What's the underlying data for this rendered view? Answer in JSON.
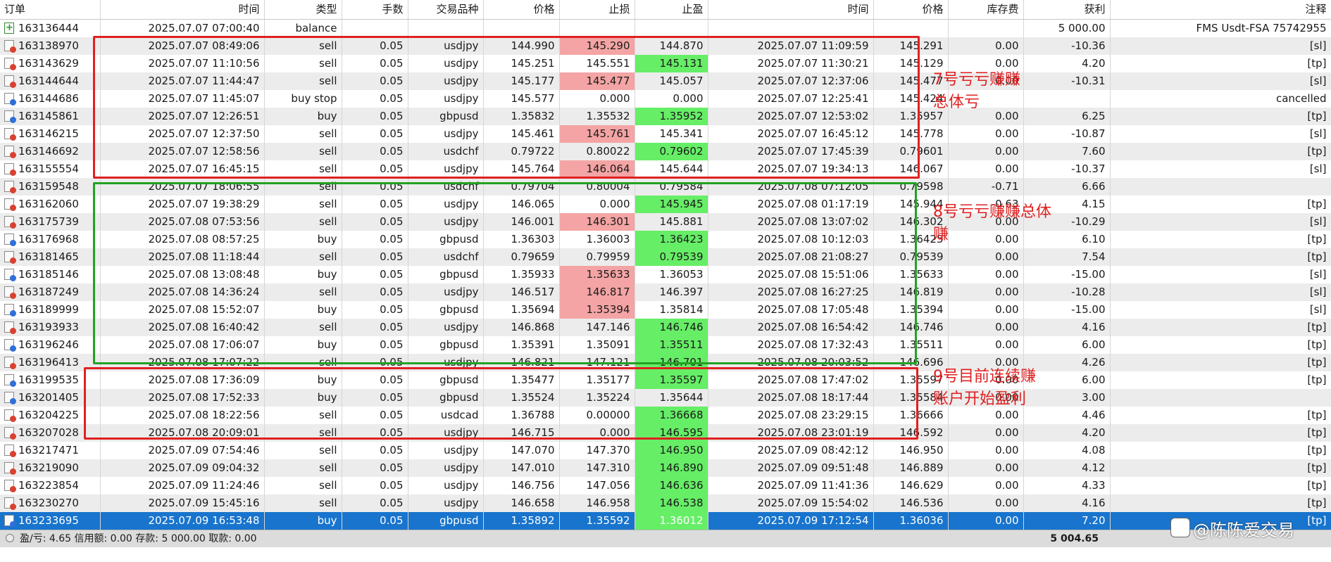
{
  "columns": {
    "order": "订单",
    "time_open": "时间",
    "type": "类型",
    "volume": "手数",
    "symbol": "交易品种",
    "price_open": "价格",
    "sl": "止损",
    "tp": "止盈",
    "time_close": "时间",
    "price_close": "价格",
    "swap": "库存费",
    "profit": "获利",
    "comment": "注释"
  },
  "rows": [
    {
      "order": "163136444",
      "time_open": "2025.07.07 07:00:40",
      "type": "balance",
      "volume": "",
      "symbol": "",
      "price_open": "",
      "sl": "",
      "tp": "",
      "time_close": "",
      "price_close": "",
      "swap": "",
      "profit": "5 000.00",
      "comment": "FMS Usdt-FSA 75742955",
      "icon": "balance-icon"
    },
    {
      "order": "163138970",
      "time_open": "2025.07.07 08:49:06",
      "type": "sell",
      "volume": "0.05",
      "symbol": "usdjpy",
      "price_open": "144.990",
      "sl": "145.290",
      "tp": "144.870",
      "time_close": "2025.07.07 11:09:59",
      "price_close": "145.291",
      "swap": "0.00",
      "profit": "-10.36",
      "comment": "[sl]",
      "hit": "sl",
      "icon": "sell-order-icon"
    },
    {
      "order": "163143629",
      "time_open": "2025.07.07 11:10:56",
      "type": "sell",
      "volume": "0.05",
      "symbol": "usdjpy",
      "price_open": "145.251",
      "sl": "145.551",
      "tp": "145.131",
      "time_close": "2025.07.07 11:30:21",
      "price_close": "145.129",
      "swap": "0.00",
      "profit": "4.20",
      "comment": "[tp]",
      "hit": "tp",
      "icon": "sell-order-icon"
    },
    {
      "order": "163144644",
      "time_open": "2025.07.07 11:44:47",
      "type": "sell",
      "volume": "0.05",
      "symbol": "usdjpy",
      "price_open": "145.177",
      "sl": "145.477",
      "tp": "145.057",
      "time_close": "2025.07.07 12:37:06",
      "price_close": "145.477",
      "swap": "0.00",
      "profit": "-10.31",
      "comment": "[sl]",
      "hit": "sl",
      "icon": "sell-order-icon"
    },
    {
      "order": "163144686",
      "time_open": "2025.07.07 11:45:07",
      "type": "buy stop",
      "volume": "0.05",
      "symbol": "usdjpy",
      "price_open": "145.577",
      "sl": "0.000",
      "tp": "0.000",
      "time_close": "2025.07.07 12:25:41",
      "price_close": "145.424",
      "swap": "",
      "profit": "",
      "comment": "cancelled",
      "hit": "",
      "icon": "buy-order-icon"
    },
    {
      "order": "163145861",
      "time_open": "2025.07.07 12:26:51",
      "type": "buy",
      "volume": "0.05",
      "symbol": "gbpusd",
      "price_open": "1.35832",
      "sl": "1.35532",
      "tp": "1.35952",
      "time_close": "2025.07.07 12:53:02",
      "price_close": "1.35957",
      "swap": "0.00",
      "profit": "6.25",
      "comment": "[tp]",
      "hit": "tp",
      "icon": "buy-order-icon"
    },
    {
      "order": "163146215",
      "time_open": "2025.07.07 12:37:50",
      "type": "sell",
      "volume": "0.05",
      "symbol": "usdjpy",
      "price_open": "145.461",
      "sl": "145.761",
      "tp": "145.341",
      "time_close": "2025.07.07 16:45:12",
      "price_close": "145.778",
      "swap": "0.00",
      "profit": "-10.87",
      "comment": "[sl]",
      "hit": "sl",
      "icon": "sell-order-icon"
    },
    {
      "order": "163146692",
      "time_open": "2025.07.07 12:58:56",
      "type": "sell",
      "volume": "0.05",
      "symbol": "usdchf",
      "price_open": "0.79722",
      "sl": "0.80022",
      "tp": "0.79602",
      "time_close": "2025.07.07 17:45:39",
      "price_close": "0.79601",
      "swap": "0.00",
      "profit": "7.60",
      "comment": "[tp]",
      "hit": "tp",
      "icon": "sell-order-icon"
    },
    {
      "order": "163155554",
      "time_open": "2025.07.07 16:45:15",
      "type": "sell",
      "volume": "0.05",
      "symbol": "usdjpy",
      "price_open": "145.764",
      "sl": "146.064",
      "tp": "145.644",
      "time_close": "2025.07.07 19:34:13",
      "price_close": "146.067",
      "swap": "0.00",
      "profit": "-10.37",
      "comment": "[sl]",
      "hit": "sl",
      "icon": "sell-order-icon"
    },
    {
      "order": "163159548",
      "time_open": "2025.07.07 18:06:55",
      "type": "sell",
      "volume": "0.05",
      "symbol": "usdchf",
      "price_open": "0.79704",
      "sl": "0.80004",
      "tp": "0.79584",
      "time_close": "2025.07.08 07:12:05",
      "price_close": "0.79598",
      "swap": "-0.71",
      "profit": "6.66",
      "comment": "",
      "hit": "",
      "icon": "sell-order-icon"
    },
    {
      "order": "163162060",
      "time_open": "2025.07.07 19:38:29",
      "type": "sell",
      "volume": "0.05",
      "symbol": "usdjpy",
      "price_open": "146.065",
      "sl": "0.000",
      "tp": "145.945",
      "time_close": "2025.07.08 01:17:19",
      "price_close": "145.944",
      "swap": "-0.63",
      "profit": "4.15",
      "comment": "[tp]",
      "hit": "tp",
      "icon": "sell-order-icon"
    },
    {
      "order": "163175739",
      "time_open": "2025.07.08 07:53:56",
      "type": "sell",
      "volume": "0.05",
      "symbol": "usdjpy",
      "price_open": "146.001",
      "sl": "146.301",
      "tp": "145.881",
      "time_close": "2025.07.08 13:07:02",
      "price_close": "146.302",
      "swap": "0.00",
      "profit": "-10.29",
      "comment": "[sl]",
      "hit": "sl",
      "icon": "sell-order-icon"
    },
    {
      "order": "163176968",
      "time_open": "2025.07.08 08:57:25",
      "type": "buy",
      "volume": "0.05",
      "symbol": "gbpusd",
      "price_open": "1.36303",
      "sl": "1.36003",
      "tp": "1.36423",
      "time_close": "2025.07.08 10:12:03",
      "price_close": "1.36425",
      "swap": "0.00",
      "profit": "6.10",
      "comment": "[tp]",
      "hit": "tp",
      "icon": "buy-order-icon"
    },
    {
      "order": "163181465",
      "time_open": "2025.07.08 11:18:44",
      "type": "sell",
      "volume": "0.05",
      "symbol": "usdchf",
      "price_open": "0.79659",
      "sl": "0.79959",
      "tp": "0.79539",
      "time_close": "2025.07.08 21:08:27",
      "price_close": "0.79539",
      "swap": "0.00",
      "profit": "7.54",
      "comment": "[tp]",
      "hit": "tp",
      "icon": "sell-order-icon"
    },
    {
      "order": "163185146",
      "time_open": "2025.07.08 13:08:48",
      "type": "buy",
      "volume": "0.05",
      "symbol": "gbpusd",
      "price_open": "1.35933",
      "sl": "1.35633",
      "tp": "1.36053",
      "time_close": "2025.07.08 15:51:06",
      "price_close": "1.35633",
      "swap": "0.00",
      "profit": "-15.00",
      "comment": "[sl]",
      "hit": "sl",
      "icon": "buy-order-icon"
    },
    {
      "order": "163187249",
      "time_open": "2025.07.08 14:36:24",
      "type": "sell",
      "volume": "0.05",
      "symbol": "usdjpy",
      "price_open": "146.517",
      "sl": "146.817",
      "tp": "146.397",
      "time_close": "2025.07.08 16:27:25",
      "price_close": "146.819",
      "swap": "0.00",
      "profit": "-10.28",
      "comment": "[sl]",
      "hit": "sl",
      "icon": "sell-order-icon"
    },
    {
      "order": "163189999",
      "time_open": "2025.07.08 15:52:07",
      "type": "buy",
      "volume": "0.05",
      "symbol": "gbpusd",
      "price_open": "1.35694",
      "sl": "1.35394",
      "tp": "1.35814",
      "time_close": "2025.07.08 17:05:48",
      "price_close": "1.35394",
      "swap": "0.00",
      "profit": "-15.00",
      "comment": "[sl]",
      "hit": "sl",
      "icon": "buy-order-icon"
    },
    {
      "order": "163193933",
      "time_open": "2025.07.08 16:40:42",
      "type": "sell",
      "volume": "0.05",
      "symbol": "usdjpy",
      "price_open": "146.868",
      "sl": "147.146",
      "tp": "146.746",
      "time_close": "2025.07.08 16:54:42",
      "price_close": "146.746",
      "swap": "0.00",
      "profit": "4.16",
      "comment": "[tp]",
      "hit": "tp",
      "icon": "sell-order-icon"
    },
    {
      "order": "163196246",
      "time_open": "2025.07.08 17:06:07",
      "type": "buy",
      "volume": "0.05",
      "symbol": "gbpusd",
      "price_open": "1.35391",
      "sl": "1.35091",
      "tp": "1.35511",
      "time_close": "2025.07.08 17:32:43",
      "price_close": "1.35511",
      "swap": "0.00",
      "profit": "6.00",
      "comment": "[tp]",
      "hit": "tp",
      "icon": "buy-order-icon"
    },
    {
      "order": "163196413",
      "time_open": "2025.07.08 17:07:22",
      "type": "sell",
      "volume": "0.05",
      "symbol": "usdjpy",
      "price_open": "146.821",
      "sl": "147.121",
      "tp": "146.701",
      "time_close": "2025.07.08 20:03:52",
      "price_close": "146.696",
      "swap": "0.00",
      "profit": "4.26",
      "comment": "[tp]",
      "hit": "tp",
      "icon": "sell-order-icon"
    },
    {
      "order": "163199535",
      "time_open": "2025.07.08 17:36:09",
      "type": "buy",
      "volume": "0.05",
      "symbol": "gbpusd",
      "price_open": "1.35477",
      "sl": "1.35177",
      "tp": "1.35597",
      "time_close": "2025.07.08 17:47:02",
      "price_close": "1.35597",
      "swap": "0.00",
      "profit": "6.00",
      "comment": "[tp]",
      "hit": "tp",
      "icon": "buy-order-icon"
    },
    {
      "order": "163201405",
      "time_open": "2025.07.08 17:52:33",
      "type": "buy",
      "volume": "0.05",
      "symbol": "gbpusd",
      "price_open": "1.35524",
      "sl": "1.35224",
      "tp": "1.35644",
      "time_close": "2025.07.08 18:17:44",
      "price_close": "1.35584",
      "swap": "0.00",
      "profit": "3.00",
      "comment": "",
      "hit": "",
      "icon": "buy-order-icon"
    },
    {
      "order": "163204225",
      "time_open": "2025.07.08 18:22:56",
      "type": "sell",
      "volume": "0.05",
      "symbol": "usdcad",
      "price_open": "1.36788",
      "sl": "0.00000",
      "tp": "1.36668",
      "time_close": "2025.07.08 23:29:15",
      "price_close": "1.36666",
      "swap": "0.00",
      "profit": "4.46",
      "comment": "[tp]",
      "hit": "tp",
      "icon": "sell-order-icon"
    },
    {
      "order": "163207028",
      "time_open": "2025.07.08 20:09:01",
      "type": "sell",
      "volume": "0.05",
      "symbol": "usdjpy",
      "price_open": "146.715",
      "sl": "0.000",
      "tp": "146.595",
      "time_close": "2025.07.08 23:01:19",
      "price_close": "146.592",
      "swap": "0.00",
      "profit": "4.20",
      "comment": "[tp]",
      "hit": "tp",
      "icon": "sell-order-icon"
    },
    {
      "order": "163217471",
      "time_open": "2025.07.09 07:54:46",
      "type": "sell",
      "volume": "0.05",
      "symbol": "usdjpy",
      "price_open": "147.070",
      "sl": "147.370",
      "tp": "146.950",
      "time_close": "2025.07.09 08:42:12",
      "price_close": "146.950",
      "swap": "0.00",
      "profit": "4.08",
      "comment": "[tp]",
      "hit": "tp",
      "icon": "sell-order-icon"
    },
    {
      "order": "163219090",
      "time_open": "2025.07.09 09:04:32",
      "type": "sell",
      "volume": "0.05",
      "symbol": "usdjpy",
      "price_open": "147.010",
      "sl": "147.310",
      "tp": "146.890",
      "time_close": "2025.07.09 09:51:48",
      "price_close": "146.889",
      "swap": "0.00",
      "profit": "4.12",
      "comment": "[tp]",
      "hit": "tp",
      "icon": "sell-order-icon"
    },
    {
      "order": "163223854",
      "time_open": "2025.07.09 11:24:46",
      "type": "sell",
      "volume": "0.05",
      "symbol": "usdjpy",
      "price_open": "146.756",
      "sl": "147.056",
      "tp": "146.636",
      "time_close": "2025.07.09 11:41:36",
      "price_close": "146.629",
      "swap": "0.00",
      "profit": "4.33",
      "comment": "[tp]",
      "hit": "tp",
      "icon": "sell-order-icon"
    },
    {
      "order": "163230270",
      "time_open": "2025.07.09 15:45:16",
      "type": "sell",
      "volume": "0.05",
      "symbol": "usdjpy",
      "price_open": "146.658",
      "sl": "146.958",
      "tp": "146.538",
      "time_close": "2025.07.09 15:54:02",
      "price_close": "146.536",
      "swap": "0.00",
      "profit": "4.16",
      "comment": "[tp]",
      "hit": "tp",
      "icon": "sell-order-icon"
    },
    {
      "order": "163233695",
      "time_open": "2025.07.09 16:53:48",
      "type": "buy",
      "volume": "0.05",
      "symbol": "gbpusd",
      "price_open": "1.35892",
      "sl": "1.35592",
      "tp": "1.36012",
      "time_close": "2025.07.09 17:12:54",
      "price_close": "1.36036",
      "swap": "0.00",
      "profit": "7.20",
      "comment": "[tp]",
      "hit": "tp",
      "icon": "buy-order-icon",
      "selected": true
    }
  ],
  "status": {
    "summary": "盈/亏: 4.65  信用额: 0.00  存款: 5 000.00  取款: 0.00",
    "total": "5 004.65"
  },
  "annotations": {
    "note_day7_line1": "7号亏亏赚赚",
    "note_day7_line2": "总体亏",
    "note_day8_line1": "8号亏亏赚赚总体",
    "note_day8_line2": "赚",
    "note_day9_line1": "9号目前连续赚",
    "note_day9_line2": "账户开始盈利"
  },
  "watermark": "@陈陈爱交易",
  "colors": {
    "sl_highlight": "#f4a4a4",
    "tp_highlight": "#66ee66",
    "selected_row": "#1874cd",
    "box_red": "#e02020",
    "box_green": "#22a222"
  }
}
